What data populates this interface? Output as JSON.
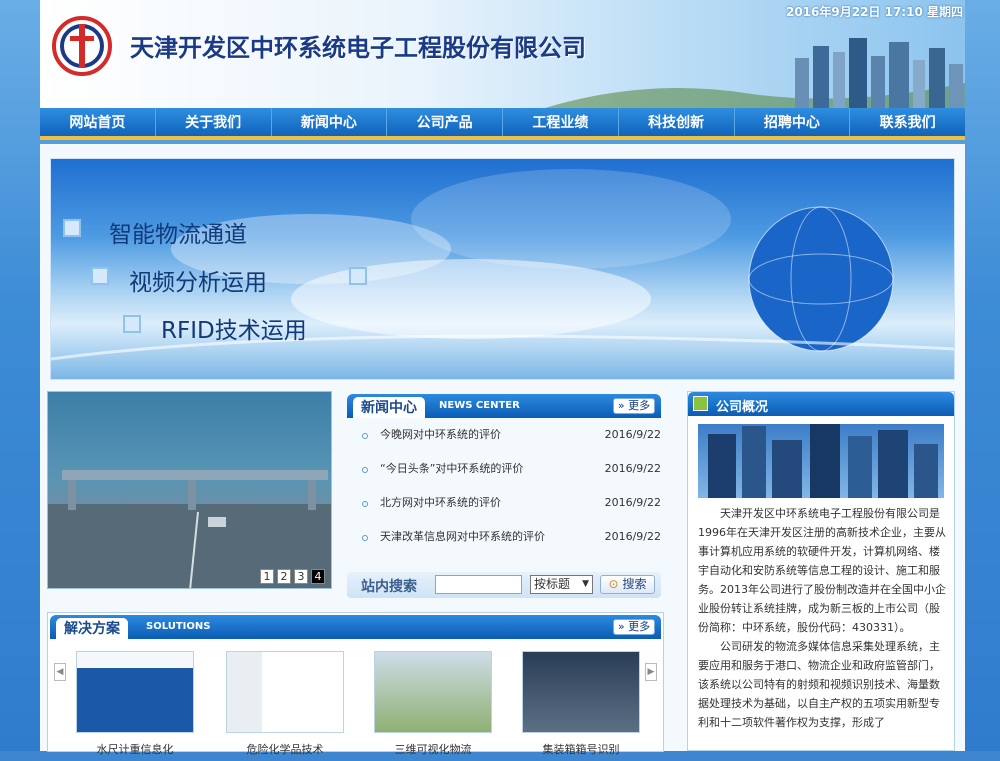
{
  "header": {
    "company_name": "天津开发区中环系统电子工程股份有限公司",
    "datetime": "2016年9月22日 17:10 星期四"
  },
  "nav": {
    "items": [
      "网站首页",
      "关于我们",
      "新闻中心",
      "公司产品",
      "工程业绩",
      "科技创新",
      "招聘中心",
      "联系我们"
    ]
  },
  "banner": {
    "lines": [
      "智能物流通道",
      "视频分析运用",
      "RFID技术运用"
    ]
  },
  "slideshow": {
    "pages": [
      "1",
      "2",
      "3",
      "4"
    ],
    "active_page": "4"
  },
  "news": {
    "title": "新闻中心",
    "title_en": "NEWS CENTER",
    "more_label": "更多",
    "items": [
      {
        "text": "今晚网对中环系统的评价",
        "date": "2016/9/22"
      },
      {
        "text": "“今日头条”对中环系统的评价",
        "date": "2016/9/22"
      },
      {
        "text": "北方网对中环系统的评价",
        "date": "2016/9/22"
      },
      {
        "text": "天津改革信息网对中环系统的评价",
        "date": "2016/9/22"
      }
    ]
  },
  "search": {
    "label": "站内搜索",
    "input_value": "",
    "select_value": "按标题",
    "button_label": "搜索"
  },
  "solutions": {
    "title": "解决方案",
    "title_en": "SOLUTIONS",
    "more_label": "更多",
    "items": [
      {
        "caption": "水尺计重信息化"
      },
      {
        "caption": "危险化学品技术"
      },
      {
        "caption": "三维可视化物流"
      },
      {
        "caption": "集装箱箱号识别"
      }
    ]
  },
  "company_overview": {
    "title": "公司概况",
    "paragraphs": [
      "天津开发区中环系统电子工程股份有限公司是1996年在天津开发区注册的高新技术企业，主要从事计算机应用系统的软硬件开发，计算机网络、楼宇自动化和安防系统等信息工程的设计、施工和服务。2013年公司进行了股份制改造并在全国中小企业股份转让系统挂牌，成为新三板的上市公司（股份简称：中环系统，股份代码：430331）。",
      "公司研发的物流多媒体信息采集处理系统，主要应用和服务于港口、物流企业和政府监管部门，该系统以公司特有的射频和视频识别技术、海量数据处理技术为基础，以自主产权的五项实用新型专利和十二项软件著作权为支撑，形成了"
    ]
  },
  "colors": {
    "nav_bg": "#1a74cc",
    "nav_border": "#f0c040",
    "brand_text": "#1a3a86",
    "page_bg": "#3e86cf"
  }
}
